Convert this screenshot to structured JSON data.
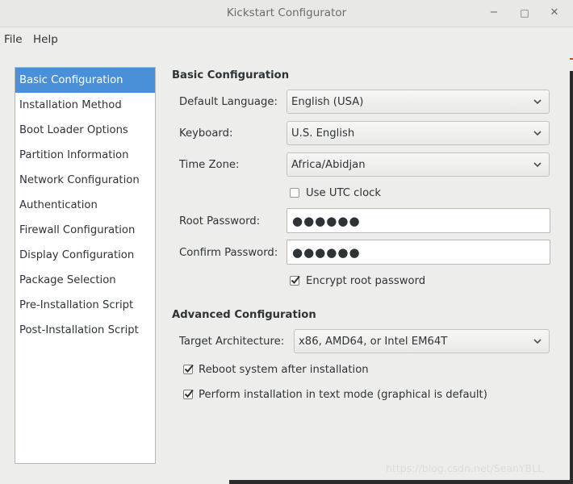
{
  "window": {
    "title": "Kickstart Configurator",
    "minimize": "−",
    "maximize": "□",
    "close": "✕"
  },
  "menu": {
    "file": "File",
    "help": "Help"
  },
  "sidebar": {
    "items": [
      {
        "label": "Basic Configuration",
        "selected": true
      },
      {
        "label": "Installation Method"
      },
      {
        "label": "Boot Loader Options"
      },
      {
        "label": "Partition Information"
      },
      {
        "label": "Network Configuration"
      },
      {
        "label": "Authentication"
      },
      {
        "label": "Firewall Configuration"
      },
      {
        "label": "Display Configuration"
      },
      {
        "label": "Package Selection"
      },
      {
        "label": "Pre-Installation Script"
      },
      {
        "label": "Post-Installation Script"
      }
    ]
  },
  "basic": {
    "heading": "Basic Configuration",
    "language_label": "Default Language:",
    "language_value": "English (USA)",
    "keyboard_label": "Keyboard:",
    "keyboard_value": "U.S. English",
    "timezone_label": "Time Zone:",
    "timezone_value": "Africa/Abidjan",
    "utc_label": "Use UTC clock",
    "utc_checked": false,
    "root_password_label": "Root Password:",
    "root_password_value": "●●●●●●",
    "confirm_password_label": "Confirm Password:",
    "confirm_password_value": "●●●●●●",
    "encrypt_label": "Encrypt root password",
    "encrypt_checked": true
  },
  "advanced": {
    "heading": "Advanced Configuration",
    "arch_label": "Target Architecture:",
    "arch_value": "x86, AMD64, or Intel EM64T",
    "reboot_label": "Reboot system after installation",
    "reboot_checked": true,
    "textmode_label": "Perform installation in text mode (graphical is default)",
    "textmode_checked": true
  },
  "watermark": "https://blog.csdn.net/SeanYBLL"
}
